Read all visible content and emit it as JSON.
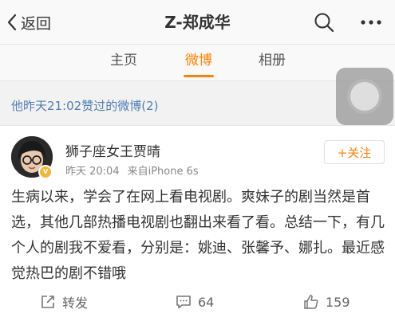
{
  "nav": {
    "back_label": "返回",
    "title": "Z-郑成华",
    "icons": {
      "search": "search-icon",
      "more": "more-icon",
      "back": "chevron-left-icon"
    }
  },
  "tabs": [
    {
      "label": "主页",
      "active": false
    },
    {
      "label": "微博",
      "active": true
    },
    {
      "label": "相册",
      "active": false
    }
  ],
  "section": {
    "header": "他昨天21:02赞过的微博(2)"
  },
  "post": {
    "author": "狮子座女王贾晴",
    "verified_badge": "v",
    "time": "昨天 20:04",
    "source": "来自iPhone 6s",
    "follow_label": "+关注",
    "text": "生病以来，学会了在网上看电视剧。爽妹子的剧当然是首选，其他几部热播电视剧也翻出来看了看。总结一下，有几个人的剧我不爱看，分别是：姚迪、张馨予、娜扎。最近感觉热巴的剧不错哦"
  },
  "actions": {
    "repost_label": "转发",
    "comments_count": "64",
    "likes_count": "159"
  },
  "colors": {
    "accent": "#ff8200",
    "link": "#4f7eb0",
    "text": "#333333",
    "meta": "#888888"
  }
}
